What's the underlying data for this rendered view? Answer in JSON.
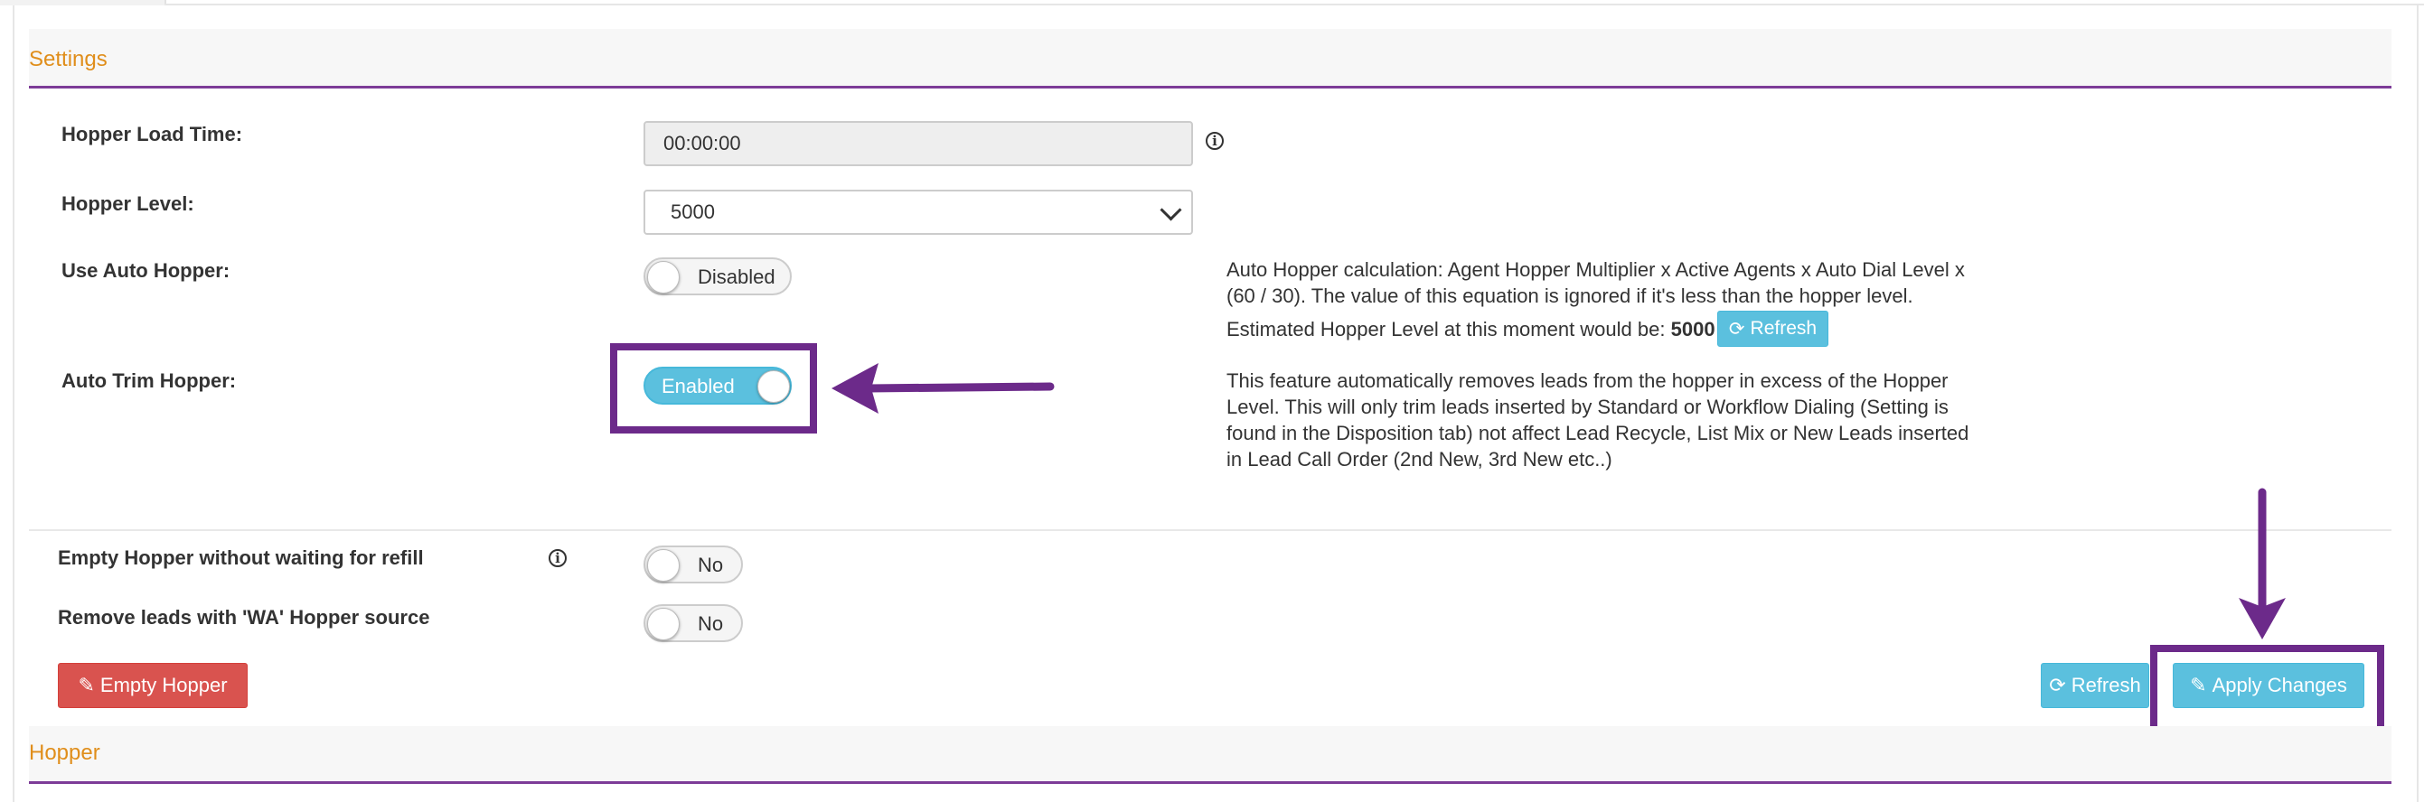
{
  "settings_section": {
    "title": "Settings"
  },
  "hopper_section": {
    "title": "Hopper"
  },
  "fields": {
    "hopper_load_time": {
      "label": "Hopper Load Time:",
      "value": "00:00:00"
    },
    "hopper_level": {
      "label": "Hopper Level:",
      "value": "5000"
    },
    "use_auto_hopper": {
      "label": "Use Auto Hopper:",
      "state": "Disabled",
      "desc_line1": "Auto Hopper calculation: Agent Hopper Multiplier x Active Agents x Auto Dial Level x",
      "desc_line2": "(60 / 30). The value of this equation is ignored if it's less than the hopper level.",
      "estimate_prefix": "Estimated Hopper Level at this moment would be:",
      "estimate_value": "5000",
      "refresh_label": "Refresh"
    },
    "auto_trim_hopper": {
      "label": "Auto Trim Hopper:",
      "state": "Enabled",
      "desc_lines": [
        "This feature automatically removes leads from the hopper in excess of the Hopper",
        "Level. This will only trim leads inserted by Standard or Workflow Dialing (Setting is",
        "found in the Disposition tab) not affect Lead Recycle, List Mix or New Leads inserted",
        "in Lead Call Order (2nd New, 3rd New etc..)"
      ]
    },
    "empty_hopper_without_wait": {
      "label": "Empty Hopper without waiting for refill",
      "state": "No"
    },
    "remove_wa_leads": {
      "label": "Remove leads with 'WA' Hopper source",
      "state": "No"
    }
  },
  "buttons": {
    "empty_hopper": "Empty Hopper",
    "refresh": "Refresh",
    "apply_changes": "Apply Changes"
  },
  "icons": {
    "info": "info-icon",
    "edit": "edit-icon",
    "refresh": "refresh-icon",
    "chevron": "chevron-down-icon"
  },
  "colors": {
    "section_title": "#e08e1b",
    "section_rule": "#7d3c98",
    "annotation": "#6c2a8a",
    "info_button": "#5bc0de",
    "danger_button": "#d9534f"
  }
}
